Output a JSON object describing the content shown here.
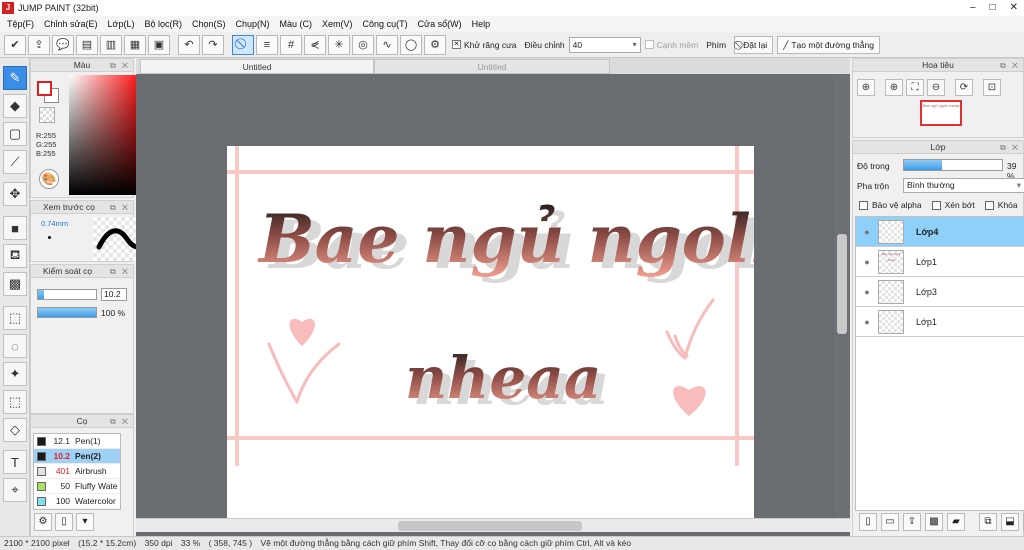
{
  "window": {
    "title": "JUMP PAINT (32bit)",
    "controls": [
      "–",
      "□",
      "✕"
    ]
  },
  "menu": [
    "Tệp(F)",
    "Chỉnh sửa(E)",
    "Lớp(L)",
    "Bộ lọc(R)",
    "Chọn(S)",
    "Chụp(N)",
    "Màu (C)",
    "Xem(V)",
    "Công cụ(T)",
    "Cửa sổ(W)",
    "Help"
  ],
  "toolbar": {
    "antialias_label": "Khử răng cưa",
    "adjust_label": "Điều chỉnh",
    "adjust_value": "40",
    "soft_edge_label": "Cạnh mềm",
    "key_label": "Phím",
    "reset_label": "Đặt lại",
    "straight_line_label": "Tạo một đường thẳng"
  },
  "color_panel": {
    "title": "Màu",
    "r": "R:255",
    "g": "G:255",
    "b": "B:255",
    "front_color": "#ffffff",
    "ring_color": "#e02020"
  },
  "preview_panel": {
    "title": "Xem trước cọ",
    "size": "0.74mm"
  },
  "brush_control": {
    "title": "Kiểm soát cọ",
    "size_value": "10.2",
    "size_fraction": 0.1,
    "opacity_value": "100 %",
    "opacity_fraction": 1.0
  },
  "brush_panel": {
    "title": "Cọ",
    "items": [
      {
        "size": "12.1",
        "name": "Pen(1)",
        "color": "#1a1a1a",
        "selected": false,
        "size_color": "#222222"
      },
      {
        "size": "10.2",
        "name": "Pen(2)",
        "color": "#1a1a1a",
        "selected": true,
        "size_color": "#e02020"
      },
      {
        "size": "401",
        "name": "Airbrush",
        "color": "#e0e0e0",
        "selected": false,
        "size_color": "#e02020"
      },
      {
        "size": "50",
        "name": "Fluffy Wate",
        "color": "#a8e060",
        "selected": false,
        "size_color": "#222222"
      },
      {
        "size": "100",
        "name": "Watercolor",
        "color": "#80e0f0",
        "selected": false,
        "size_color": "#222222"
      }
    ]
  },
  "tabs": {
    "active": "Untitled",
    "inactive": "Untitled"
  },
  "artwork": {
    "line1": "Bae ngủ ngoll",
    "line2": "nheaa",
    "frame_color": "#f8c8c4",
    "heart_color": "#f9bcbc",
    "text_gradient_top": "#1a1a1a",
    "text_gradient_bottom": "#f4a090"
  },
  "navigator": {
    "title": "Hoa tiêu",
    "thumb_text": "Bae ngủ ngoll nheaa"
  },
  "layer_panel": {
    "title": "Lớp",
    "opacity_label": "Độ trong",
    "opacity_value": "39 %",
    "opacity_fraction": 0.39,
    "blend_label": "Pha trộn",
    "blend_value": "Bình thường",
    "protect_alpha": "Bảo vệ alpha",
    "clipping": "Xén bớt",
    "lock": "Khóa",
    "layers": [
      {
        "name": "Lớp4",
        "selected": true,
        "thumb": ""
      },
      {
        "name": "Lớp1",
        "selected": false,
        "thumb": "Bae ngủ ngoll nheaa"
      },
      {
        "name": "Lớp3",
        "selected": false,
        "thumb": ""
      },
      {
        "name": "Lớp1",
        "selected": false,
        "thumb": ""
      }
    ]
  },
  "status": {
    "size": "2100 * 2100 pixel",
    "cm": "(15.2 * 15.2cm)",
    "dpi": "350 dpi",
    "zoom": "33 %",
    "coords": "( 358, 745 )",
    "hint": "Vẽ một đường thẳng bằng cách giữ phím Shift, Thay đổi cỡ cọ bằng cách giữ phím Ctrl, Alt và kéo"
  }
}
